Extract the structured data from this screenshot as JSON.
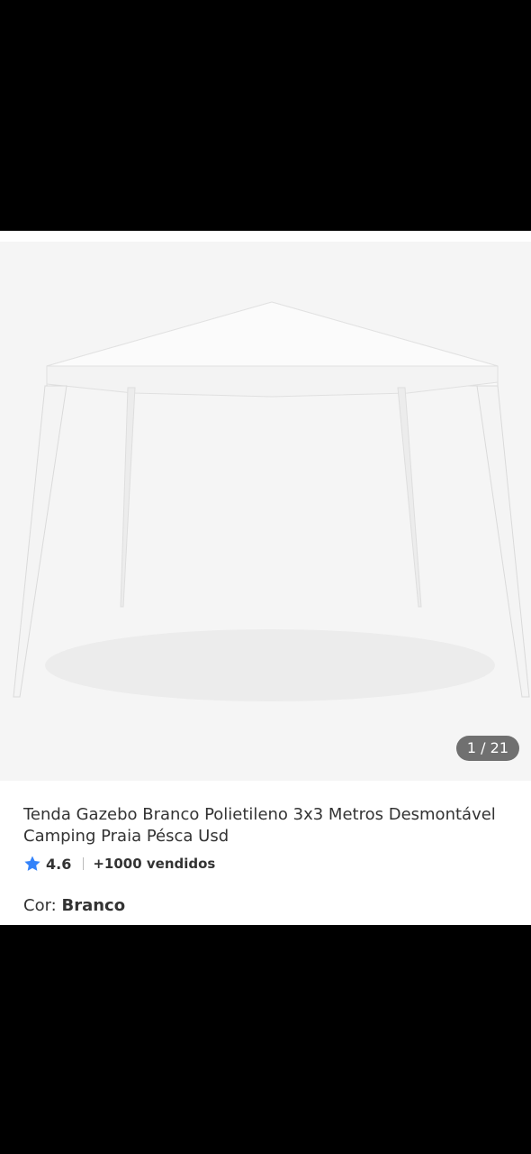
{
  "product": {
    "image_alt": "Tenda gazebo branco",
    "image_counter": "1 / 21",
    "title": "Tenda Gazebo Branco Polietileno 3x3 Metros Desmontável Camping Praia Pésca Usd",
    "rating": "4.6",
    "sold": "+1000 vendidos",
    "color_label": "Cor:",
    "color_value": "Branco"
  },
  "icons": {
    "rating": "star-icon"
  },
  "colors": {
    "star": "#3483fa",
    "counter_bg": "#707070",
    "background": "#000000",
    "gallery_bg": "#f5f5f5"
  }
}
